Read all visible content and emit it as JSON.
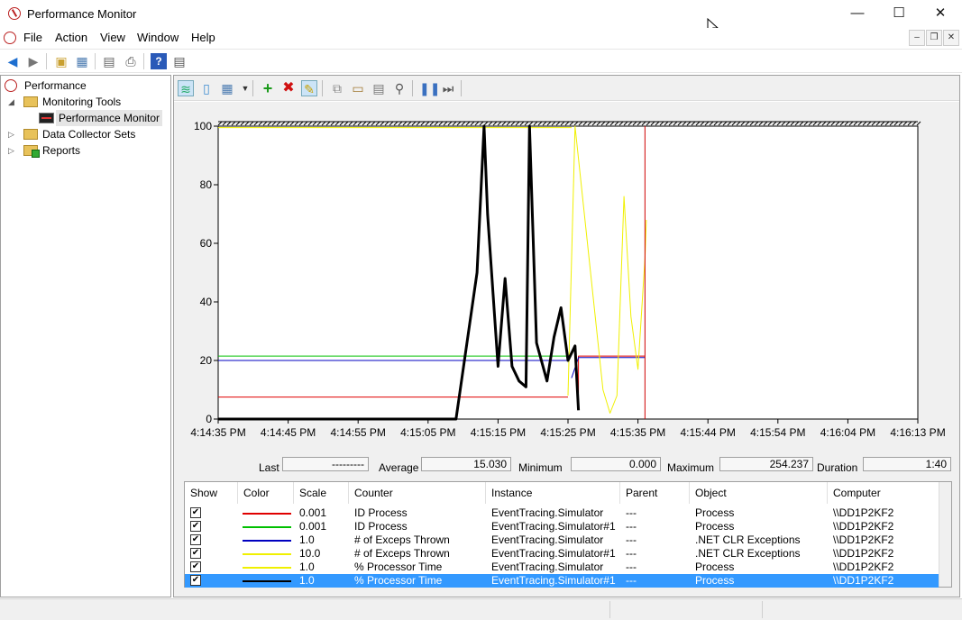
{
  "window": {
    "title": "Performance Monitor",
    "minimize_glyph": "—",
    "maximize_glyph": "☐",
    "close_glyph": "✕"
  },
  "menu": {
    "items": [
      "File",
      "Action",
      "View",
      "Window",
      "Help"
    ],
    "mdi_minimize": "–",
    "mdi_restore": "❐",
    "mdi_close": "✕"
  },
  "tree": {
    "root": "Performance",
    "monitoring_tools": "Monitoring Tools",
    "performance_monitor": "Performance Monitor",
    "data_collector_sets": "Data Collector Sets",
    "reports": "Reports"
  },
  "stats": {
    "last_label": "Last",
    "last_value": "---------",
    "average_label": "Average",
    "average_value": "15.030",
    "minimum_label": "Minimum",
    "minimum_value": "0.000",
    "maximum_label": "Maximum",
    "maximum_value": "254.237",
    "duration_label": "Duration",
    "duration_value": "1:40"
  },
  "legend": {
    "headers": [
      "Show",
      "Color",
      "Scale",
      "Counter",
      "Instance",
      "Parent",
      "Object",
      "Computer"
    ],
    "rows": [
      {
        "color": "#e00000",
        "scale": "0.001",
        "counter": "ID Process",
        "instance": "EventTracing.Simulator",
        "parent": "---",
        "object": "Process",
        "computer": "\\\\DD1P2KF2",
        "selected": false
      },
      {
        "color": "#00c000",
        "scale": "0.001",
        "counter": "ID Process",
        "instance": "EventTracing.Simulator#1",
        "parent": "---",
        "object": "Process",
        "computer": "\\\\DD1P2KF2",
        "selected": false
      },
      {
        "color": "#0000c0",
        "scale": "1.0",
        "counter": "# of Exceps Thrown",
        "instance": "EventTracing.Simulator",
        "parent": "---",
        "object": ".NET CLR Exceptions",
        "computer": "\\\\DD1P2KF2",
        "selected": false
      },
      {
        "color": "#f0f000",
        "scale": "10.0",
        "counter": "# of Exceps Thrown",
        "instance": "EventTracing.Simulator#1",
        "parent": "---",
        "object": ".NET CLR Exceptions",
        "computer": "\\\\DD1P2KF2",
        "selected": false
      },
      {
        "color": "#f0f000",
        "scale": "1.0",
        "counter": "% Processor Time",
        "instance": "EventTracing.Simulator",
        "parent": "---",
        "object": "Process",
        "computer": "\\\\DD1P2KF2",
        "selected": false
      },
      {
        "color": "#000000",
        "scale": "1.0",
        "counter": "% Processor Time",
        "instance": "EventTracing.Simulator#1",
        "parent": "---",
        "object": "Process",
        "computer": "\\\\DD1P2KF2",
        "selected": true
      }
    ]
  },
  "chart_data": {
    "type": "line",
    "ylim": [
      0,
      100
    ],
    "y_ticks": [
      0,
      20,
      40,
      60,
      80,
      100
    ],
    "x_tick_labels": [
      "4:14:35 PM",
      "4:14:45 PM",
      "4:14:55 PM",
      "4:15:05 PM",
      "4:15:15 PM",
      "4:15:25 PM",
      "4:15:35 PM",
      "4:15:44 PM",
      "4:15:54 PM",
      "4:16:04 PM",
      "4:16:13 PM"
    ],
    "x_range": [
      0,
      100
    ],
    "cursor_x": 61,
    "grid": false,
    "series": [
      {
        "color": "#e00000",
        "width": 1,
        "points": [
          [
            0,
            7.5
          ],
          [
            50,
            7.5
          ],
          [
            50,
            7.5
          ],
          [
            61,
            7.5
          ]
        ],
        "segments": [
          [
            [
              0,
              7.5
            ],
            [
              50,
              7.5
            ]
          ],
          [
            [
              51.5,
              9
            ],
            [
              51.5,
              21.5
            ],
            [
              61,
              21.5
            ]
          ]
        ]
      },
      {
        "color": "#00c000",
        "width": 1,
        "segments": [
          [
            [
              0,
              21.5
            ],
            [
              50,
              21.5
            ]
          ]
        ]
      },
      {
        "color": "#0000c0",
        "width": 1,
        "segments": [
          [
            [
              0,
              20
            ],
            [
              50,
              20
            ]
          ],
          [
            [
              50.5,
              14
            ],
            [
              51.5,
              21
            ],
            [
              61,
              21
            ]
          ]
        ]
      },
      {
        "color": "#f0f000",
        "width": 1,
        "segments": [
          [
            [
              0,
              99.5
            ],
            [
              50.5,
              99.5
            ]
          ]
        ]
      },
      {
        "color": "#f0f000",
        "width": 1,
        "segments": [
          [
            [
              50,
              8
            ],
            [
              51,
              100
            ],
            [
              53,
              55
            ],
            [
              55,
              10
            ],
            [
              56,
              2
            ],
            [
              57,
              8
            ],
            [
              58,
              76
            ],
            [
              59,
              35
            ],
            [
              60,
              17
            ],
            [
              61,
              55
            ],
            [
              61.2,
              68
            ]
          ]
        ]
      },
      {
        "color": "#000000",
        "width": 3,
        "segments": [
          [
            [
              0,
              0
            ],
            [
              34,
              0
            ],
            [
              37,
              50
            ],
            [
              38,
              100
            ],
            [
              38.5,
              70
            ],
            [
              40,
              18
            ],
            [
              41,
              48
            ],
            [
              42,
              18
            ],
            [
              43,
              13
            ],
            [
              44,
              11
            ],
            [
              44.5,
              100
            ],
            [
              45.5,
              26
            ],
            [
              47,
              13
            ],
            [
              48,
              28
            ],
            [
              49,
              38
            ],
            [
              50,
              20
            ],
            [
              51,
              25
            ],
            [
              51.5,
              3
            ]
          ]
        ]
      }
    ]
  }
}
